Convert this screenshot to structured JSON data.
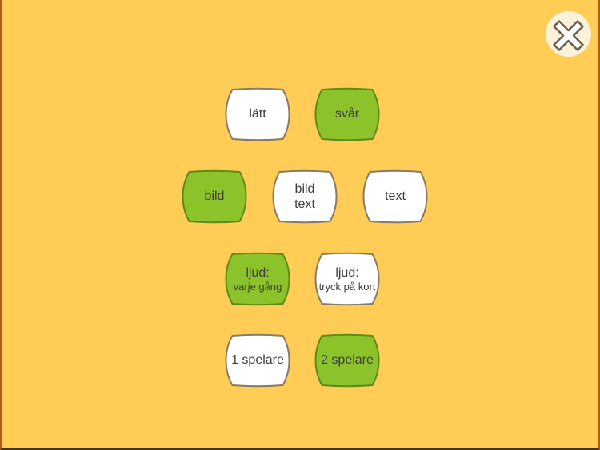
{
  "app": {
    "background_color": "#FFCC55",
    "accent_selected_color": "#8CC22A",
    "accent_selected_border_color": "#5E8A18",
    "unselected_fill_color": "#FFFFFF",
    "unselected_border_color": "#8A7A63",
    "text_color": "#3C3C3C",
    "close_circle_color": "#FCF2DA"
  },
  "close_button": {
    "icon": "close-x-icon",
    "label": ""
  },
  "settings": {
    "rows": [
      {
        "name": "difficulty",
        "options": [
          {
            "line1": "lätt",
            "line2": "",
            "selected": false,
            "small_second_line": false
          },
          {
            "line1": "svår",
            "line2": "",
            "selected": true,
            "small_second_line": false
          }
        ]
      },
      {
        "name": "card-content",
        "options": [
          {
            "line1": "bild",
            "line2": "",
            "selected": true,
            "small_second_line": false
          },
          {
            "line1": "bild",
            "line2": "text",
            "selected": false,
            "small_second_line": false
          },
          {
            "line1": "text",
            "line2": "",
            "selected": false,
            "small_second_line": false
          }
        ]
      },
      {
        "name": "sound-mode",
        "options": [
          {
            "line1": "ljud:",
            "line2": "varje gång",
            "selected": true,
            "small_second_line": true
          },
          {
            "line1": "ljud:",
            "line2": "tryck på kort",
            "selected": false,
            "small_second_line": true
          }
        ]
      },
      {
        "name": "player-count",
        "options": [
          {
            "line1": "1 spelare",
            "line2": "",
            "selected": false,
            "small_second_line": false
          },
          {
            "line1": "2 spelare",
            "line2": "",
            "selected": true,
            "small_second_line": false
          }
        ]
      }
    ]
  }
}
